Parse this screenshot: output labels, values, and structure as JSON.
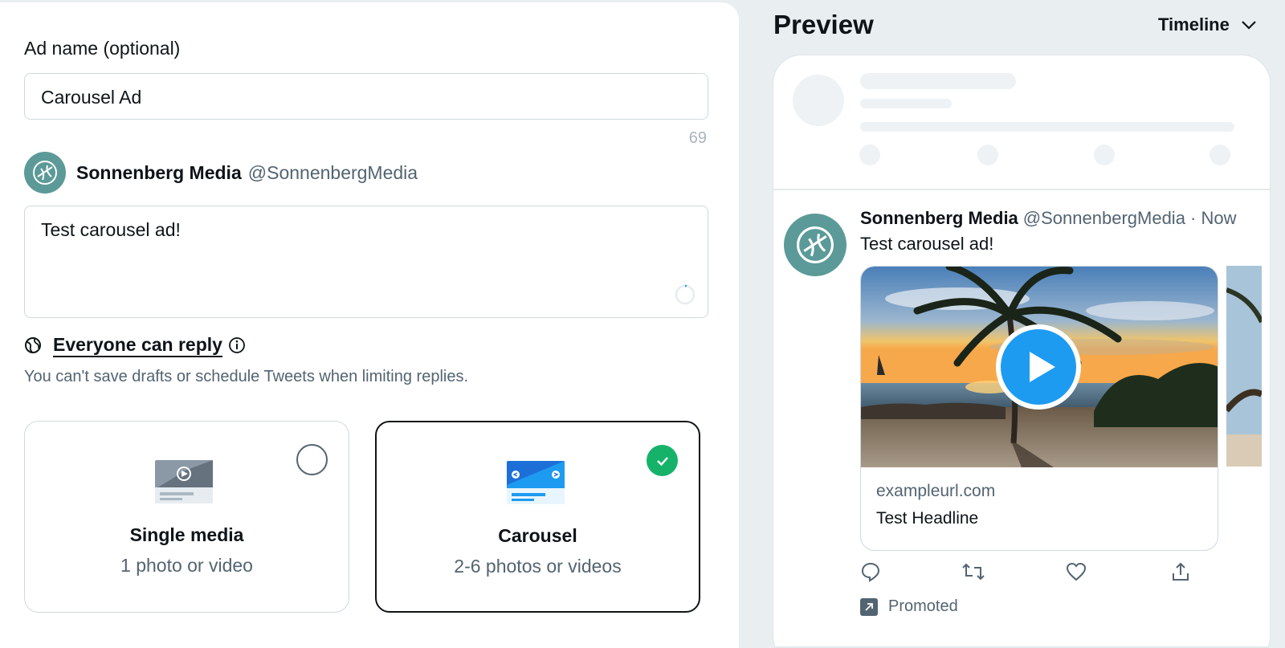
{
  "ad_name": {
    "label": "Ad name (optional)",
    "value": "Carousel Ad",
    "counter": "69"
  },
  "account": {
    "name": "Sonnenberg Media",
    "handle": "@SonnenbergMedia",
    "avatar_color": "#5b9a98"
  },
  "tweet": {
    "text": "Test carousel ad!"
  },
  "reply": {
    "label": "Everyone can reply",
    "note": "You can't save drafts or schedule Tweets when limiting replies."
  },
  "format_options": [
    {
      "title": "Single media",
      "subtitle": "1 photo or video",
      "selected": false
    },
    {
      "title": "Carousel",
      "subtitle": "2-6 photos or videos",
      "selected": true
    }
  ],
  "preview": {
    "title": "Preview",
    "placement": "Timeline",
    "tweet": {
      "name": "Sonnenberg Media",
      "handle": "@SonnenbergMedia · Now",
      "text": "Test carousel ad!",
      "card_url": "exampleurl.com",
      "card_headline": "Test Headline"
    },
    "promoted_label": "Promoted"
  },
  "colors": {
    "accent_blue": "#1d9bf0",
    "check_green": "#17b26a",
    "text_secondary": "#536471"
  }
}
